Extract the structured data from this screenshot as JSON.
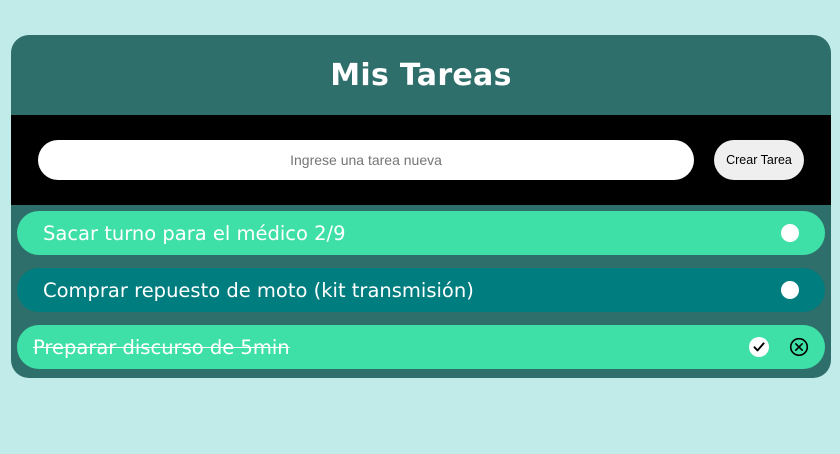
{
  "header": {
    "title": "Mis Tareas"
  },
  "form": {
    "placeholder": "Ingrese una tarea nueva",
    "value": "",
    "create_label": "Crear Tarea"
  },
  "tasks": [
    {
      "text": "Sacar turno para el médico 2/9",
      "completed": false,
      "variant": "light"
    },
    {
      "text": "Comprar repuesto de moto (kit transmisión)",
      "completed": false,
      "variant": "dark"
    },
    {
      "text": "Preparar discurso de 5min",
      "completed": true,
      "variant": "light"
    }
  ],
  "icons": {
    "complete": "check-circle-icon",
    "delete": "close-circle-icon",
    "toggle": "radio-circle-icon"
  },
  "colors": {
    "page_background": "#c0ebe8",
    "app_background": "#2e6e6b",
    "form_background": "#000000",
    "task_light": "#3ee0a8",
    "task_dark": "#007d7e"
  }
}
